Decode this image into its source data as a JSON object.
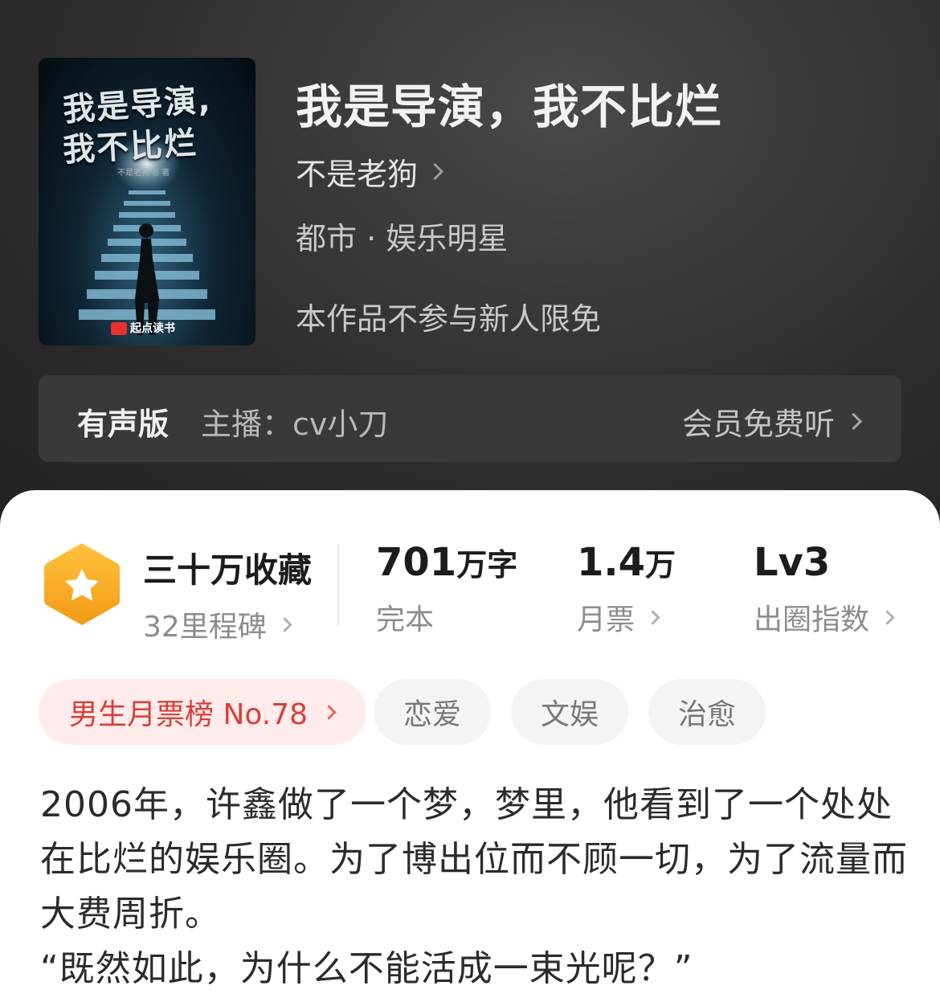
{
  "book": {
    "title": "我是导演，我不比烂",
    "author": "不是老狗",
    "category": "都市 · 娱乐明星",
    "notice": "本作品不参与新人限免",
    "cover": {
      "line1": "我是导演,",
      "line2": "我不比烂",
      "author_small": "不是老狗 ◎ 著",
      "publisher": "起点读书"
    }
  },
  "audio": {
    "label": "有声版",
    "host": "主播：cv小刀",
    "action": "会员免费听"
  },
  "stats": {
    "collection_main": "三十万收藏",
    "collection_sub": "32里程碑",
    "words_num": "701",
    "words_unit": "万字",
    "words_sub": "完本",
    "tickets_num": "1.4",
    "tickets_unit": "万",
    "tickets_sub": "月票",
    "level_main": "Lv3",
    "level_sub": "出圈指数"
  },
  "tags": {
    "rank": "男生月票榜 No.78",
    "items": [
      "恋爱",
      "文娱",
      "治愈"
    ]
  },
  "description": {
    "line1": "2006年，许鑫做了一个梦，梦里，他看到了一个处处在比烂的娱乐圈。为了博出位而不顾一切，为了流量而大费周折。",
    "line2": "“既然如此，为什么不能活成一束光呢？”"
  },
  "colors": {
    "header_bg": "#2f2d2d",
    "rank_tag_bg": "#fdeceb",
    "rank_tag_text": "#d9403a",
    "badge_orange": "#f5a623"
  }
}
